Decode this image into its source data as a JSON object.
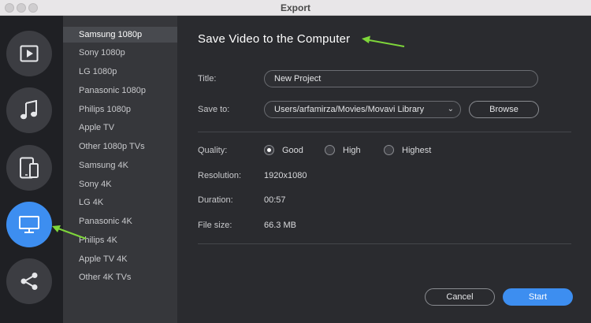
{
  "window": {
    "title": "Export"
  },
  "rail": {
    "items": [
      {
        "id": "video",
        "icon": "play-icon",
        "active": false
      },
      {
        "id": "audio",
        "icon": "music-note-icon",
        "active": false
      },
      {
        "id": "devices",
        "icon": "devices-icon",
        "active": false
      },
      {
        "id": "computer",
        "icon": "monitor-icon",
        "active": true
      },
      {
        "id": "share",
        "icon": "share-icon",
        "active": false
      }
    ]
  },
  "presets": {
    "items": [
      {
        "label": "Samsung 1080p",
        "selected": true
      },
      {
        "label": "Sony 1080p"
      },
      {
        "label": "LG 1080p"
      },
      {
        "label": "Panasonic 1080p"
      },
      {
        "label": "Philips 1080p"
      },
      {
        "label": "Apple TV"
      },
      {
        "label": "Other 1080p TVs"
      },
      {
        "label": "Samsung 4K"
      },
      {
        "label": "Sony 4K"
      },
      {
        "label": "LG 4K"
      },
      {
        "label": "Panasonic 4K"
      },
      {
        "label": "Philips 4K"
      },
      {
        "label": "Apple TV 4K"
      },
      {
        "label": "Other 4K TVs"
      }
    ]
  },
  "main": {
    "heading": "Save Video to the Computer",
    "title_label": "Title:",
    "title_value": "New Project",
    "saveto_label": "Save to:",
    "saveto_value": "Users/arfamirza/Movies/Movavi Library",
    "browse_label": "Browse",
    "quality_label": "Quality:",
    "quality_options": [
      {
        "label": "Good",
        "checked": true
      },
      {
        "label": "High",
        "checked": false
      },
      {
        "label": "Highest",
        "checked": false
      }
    ],
    "resolution_label": "Resolution:",
    "resolution_value": "1920x1080",
    "duration_label": "Duration:",
    "duration_value": "00:57",
    "filesize_label": "File size:",
    "filesize_value": "66.3 MB",
    "cancel_label": "Cancel",
    "start_label": "Start"
  },
  "colors": {
    "accent": "#3d8ef0",
    "annotation_arrow": "#7ed63a"
  }
}
